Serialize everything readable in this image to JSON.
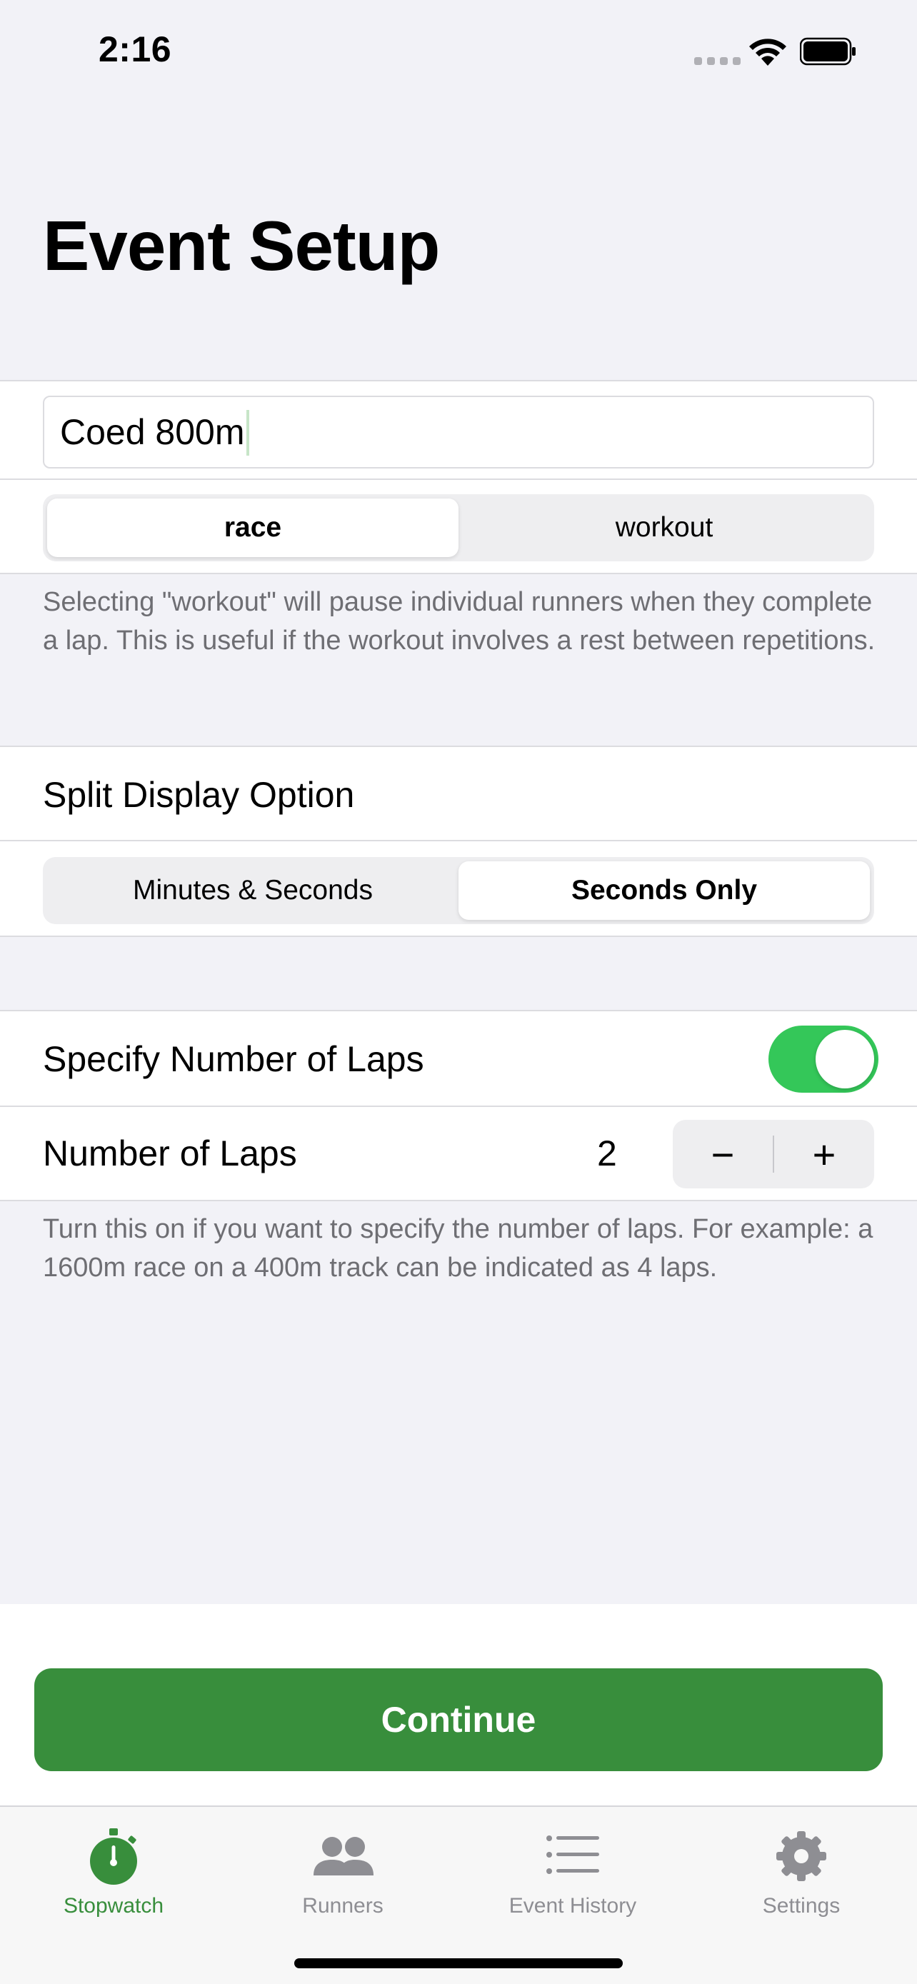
{
  "status_bar": {
    "time": "2:16"
  },
  "header": {
    "title": "Event Setup"
  },
  "event": {
    "name_value": "Coed 800m",
    "type_segments": [
      "race",
      "workout"
    ],
    "type_selected": "race",
    "type_footnote": "Selecting \"workout\" will pause individual runners when they complete a lap. This is useful if the workout involves a rest between repetitions."
  },
  "split_display": {
    "label": "Split Display Option",
    "segments": [
      "Minutes & Seconds",
      "Seconds Only"
    ],
    "selected": "Seconds Only"
  },
  "laps": {
    "specify_label": "Specify Number of Laps",
    "specify_on": true,
    "count_label": "Number of Laps",
    "count_value": "2",
    "minus_symbol": "−",
    "plus_symbol": "+",
    "footnote": "Turn this on if you want to specify the number of laps. For example: a 1600m race on a 400m track can be indicated as 4 laps."
  },
  "actions": {
    "continue_label": "Continue"
  },
  "tab_bar": {
    "tabs": [
      {
        "label": "Stopwatch",
        "icon": "stopwatch-icon",
        "active": true
      },
      {
        "label": "Runners",
        "icon": "people-icon",
        "active": false
      },
      {
        "label": "Event History",
        "icon": "list-icon",
        "active": false
      },
      {
        "label": "Settings",
        "icon": "gear-icon",
        "active": false
      }
    ]
  },
  "colors": {
    "accent": "#388e3c",
    "toggle_on": "#34c759",
    "background": "#f2f2f7",
    "secondary_text": "#6e6e73",
    "inactive_tab": "#8e8e93"
  }
}
